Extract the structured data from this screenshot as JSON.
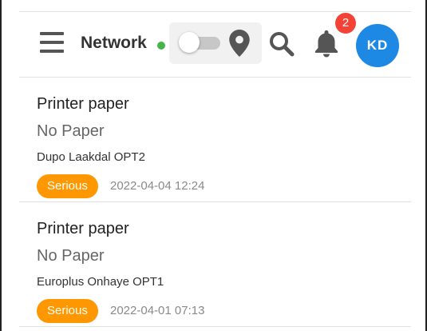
{
  "header": {
    "title": "Network",
    "status_color": "#43b649",
    "notifications_count": "2",
    "user_initials": "KD",
    "avatar_color": "#1e88e5",
    "toggle_on": false
  },
  "alerts": [
    {
      "title": "Printer paper",
      "status": "No Paper",
      "site": "Dupo Laakdal OPT2",
      "severity": "Serious",
      "severity_color": "#ff9800",
      "timestamp": "2022-04-04 12:24"
    },
    {
      "title": "Printer paper",
      "status": "No Paper",
      "site": "Europlus Onhaye OPT1",
      "severity": "Serious",
      "severity_color": "#ff9800",
      "timestamp": "2022-04-01 07:13"
    }
  ],
  "icons": {
    "menu": "menu-icon",
    "location": "map-pin-icon",
    "search": "search-icon",
    "notifications": "bell-icon"
  }
}
